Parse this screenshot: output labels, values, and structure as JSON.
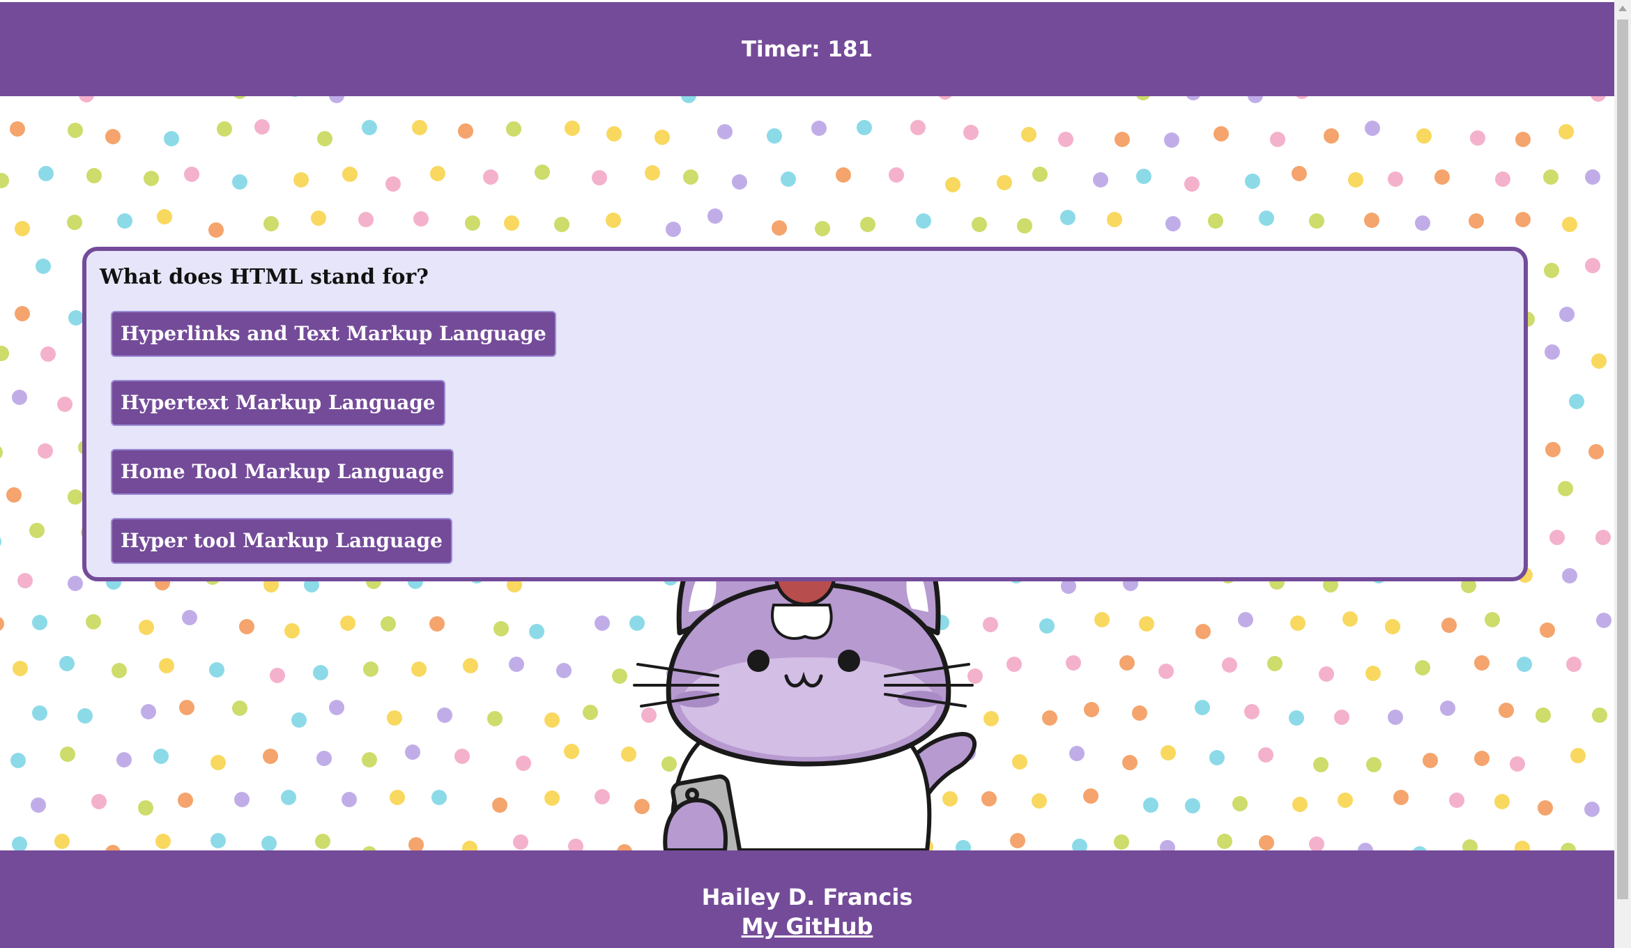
{
  "header": {
    "timer_text": "Timer: 181"
  },
  "quiz": {
    "question": "What does HTML stand for?",
    "answers": [
      "Hyperlinks and Text Markup Language",
      "Hypertext Markup Language",
      "Home Tool Markup Language",
      "Hyper tool Markup Language"
    ]
  },
  "footer": {
    "author": "Hailey D. Francis",
    "github_link": "My GitHub"
  },
  "colors": {
    "brand_purple": "#744b99",
    "card_background": "#e6e5f9",
    "dot_colors": [
      "#c8d85a",
      "#7fd6e6",
      "#f7d44c",
      "#f3a8c6",
      "#f39a5c",
      "#b9a4e6"
    ]
  },
  "background": {
    "pattern": "polka-dots",
    "illustration": "purple-cat-with-apple-and-phone"
  }
}
